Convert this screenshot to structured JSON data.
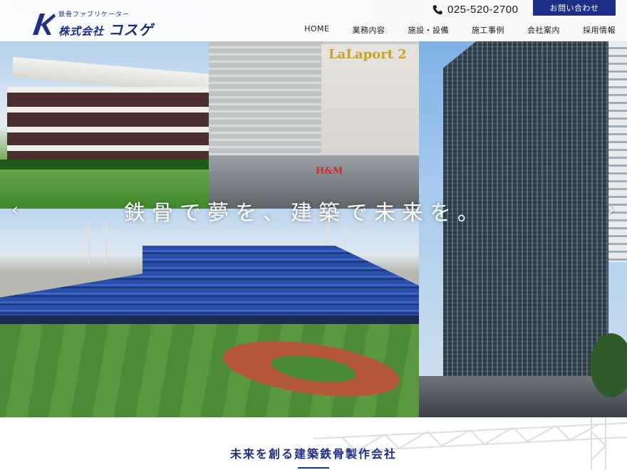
{
  "header": {
    "brand_sub": "鉄骨ファブリケーター",
    "brand_prefix": "株式会社",
    "brand_name": "コスゲ",
    "phone_icon": "phone-icon",
    "phone": "025-520-2700",
    "contact_label": "お問い合わせ"
  },
  "nav": {
    "items": [
      {
        "label": "HOME"
      },
      {
        "label": "業務内容"
      },
      {
        "label": "施設・設備"
      },
      {
        "label": "施工事例"
      },
      {
        "label": "会社案内"
      },
      {
        "label": "採用情報"
      }
    ]
  },
  "hero": {
    "tagline": "鉄骨で夢を、建築で未来を。",
    "prev_icon": "chevron-left-icon",
    "next_icon": "chevron-right-icon",
    "mall_sign": "LaLaport 2",
    "store_sign": "H&M"
  },
  "section": {
    "title": "未来を創る建築鉄骨製作会社"
  },
  "colors": {
    "brand": "#1f2f86",
    "header_bg": "#ffffff",
    "tagline": "#ffffff"
  }
}
